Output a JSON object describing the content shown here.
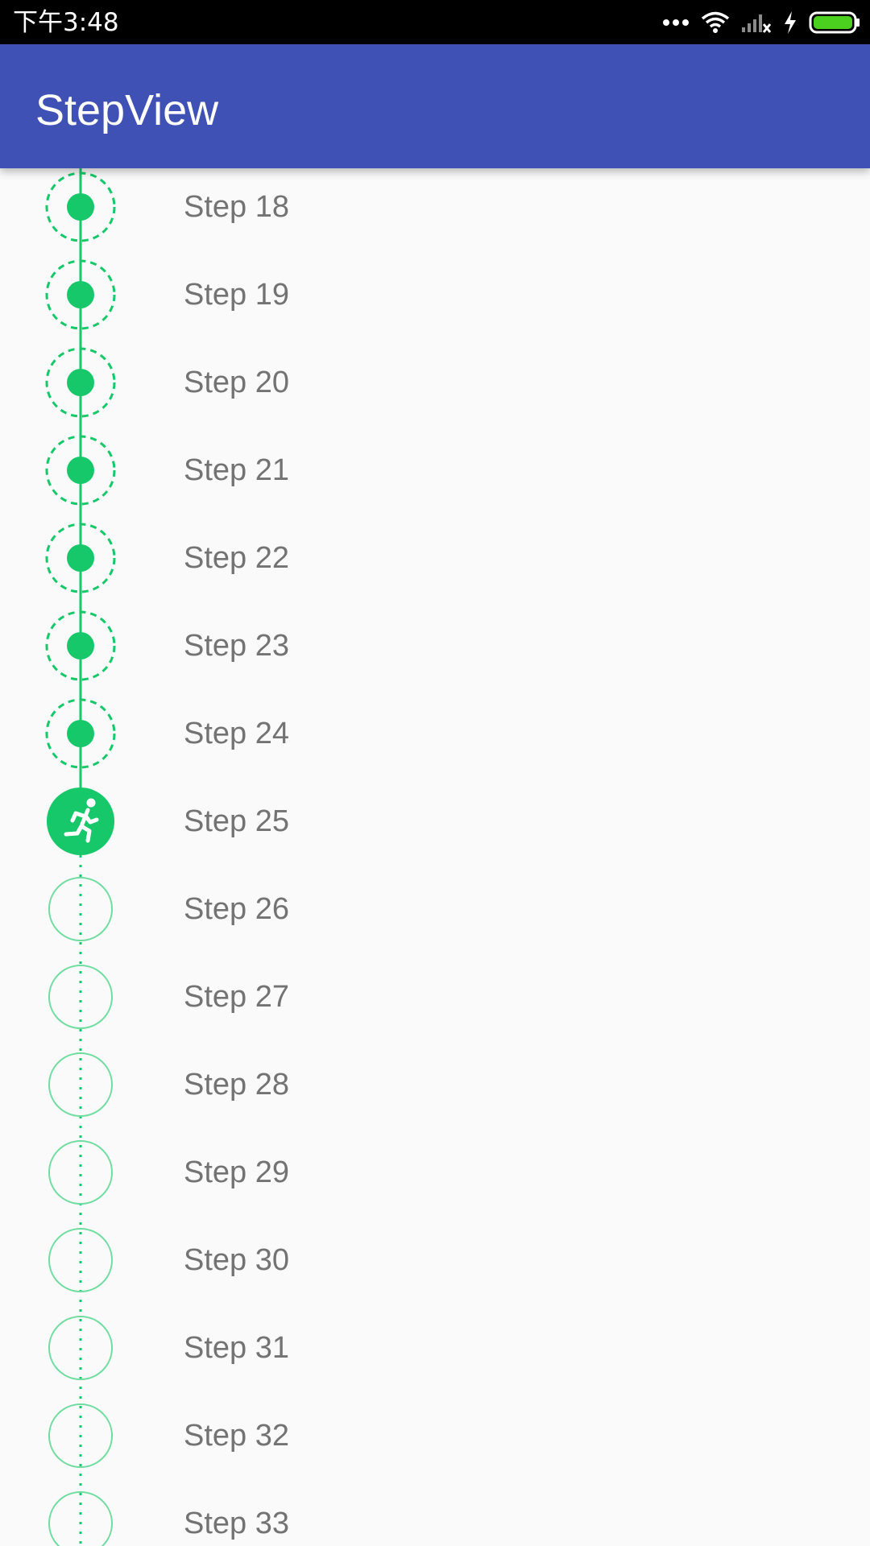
{
  "status_bar": {
    "time": "下午3:48"
  },
  "app_bar": {
    "title": "StepView"
  },
  "colors": {
    "status_bar": "#000000",
    "app_bar": "#3f51b5",
    "accent_green": "#17c86a",
    "label_text": "#737373",
    "battery_green": "#4cd01f"
  },
  "icons": {
    "status": [
      "more-dots-icon",
      "wifi-icon",
      "signal-no-sim-icon",
      "charging-bolt-icon",
      "battery-icon"
    ],
    "current_step": "running-person-icon"
  },
  "steps": [
    {
      "label": "Step 18",
      "state": "completed"
    },
    {
      "label": "Step 19",
      "state": "completed"
    },
    {
      "label": "Step 20",
      "state": "completed"
    },
    {
      "label": "Step 21",
      "state": "completed"
    },
    {
      "label": "Step 22",
      "state": "completed"
    },
    {
      "label": "Step 23",
      "state": "completed"
    },
    {
      "label": "Step 24",
      "state": "completed"
    },
    {
      "label": "Step 25",
      "state": "current"
    },
    {
      "label": "Step 26",
      "state": "pending"
    },
    {
      "label": "Step 27",
      "state": "pending"
    },
    {
      "label": "Step 28",
      "state": "pending"
    },
    {
      "label": "Step 29",
      "state": "pending"
    },
    {
      "label": "Step 30",
      "state": "pending"
    },
    {
      "label": "Step 31",
      "state": "pending"
    },
    {
      "label": "Step 32",
      "state": "pending"
    },
    {
      "label": "Step 33",
      "state": "pending"
    }
  ]
}
